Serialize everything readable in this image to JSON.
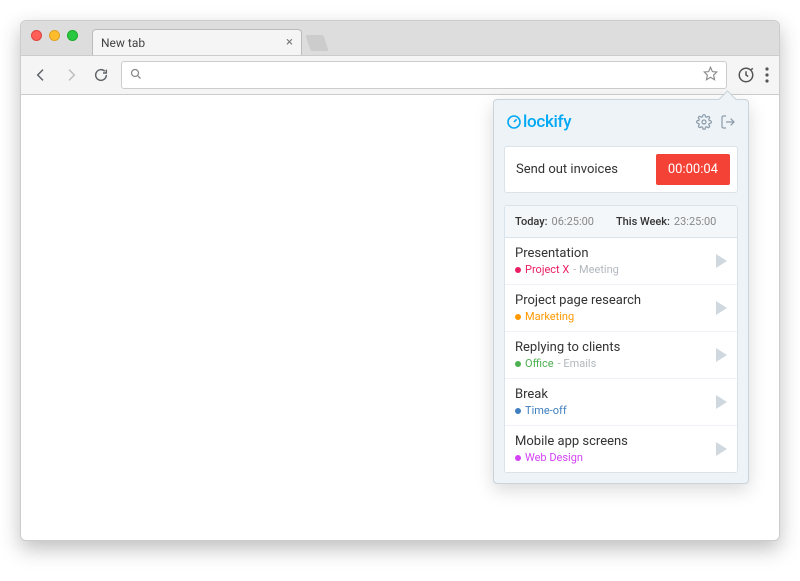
{
  "browser": {
    "tab_title": "New tab",
    "omnibox_value": "",
    "omnibox_placeholder": ""
  },
  "popup": {
    "brand": "lockify",
    "tracker": {
      "description": "Send out invoices",
      "elapsed": "00:00:04"
    },
    "summary": {
      "today_label": "Today:",
      "today_value": "06:25:00",
      "week_label": "This Week:",
      "week_value": "23:25:00"
    },
    "entries": [
      {
        "title": "Presentation",
        "project": "Project X",
        "project_color": "#e91e63",
        "tag": "Meeting"
      },
      {
        "title": "Project page research",
        "project": "Marketing",
        "project_color": "#ff9800",
        "tag": ""
      },
      {
        "title": "Replying to clients",
        "project": "Office",
        "project_color": "#4caf50",
        "tag": "Emails"
      },
      {
        "title": "Break",
        "project": "Time-off",
        "project_color": "#3f7fbf",
        "tag": ""
      },
      {
        "title": "Mobile app screens",
        "project": "Web Design",
        "project_color": "#d442f5",
        "tag": ""
      }
    ]
  }
}
